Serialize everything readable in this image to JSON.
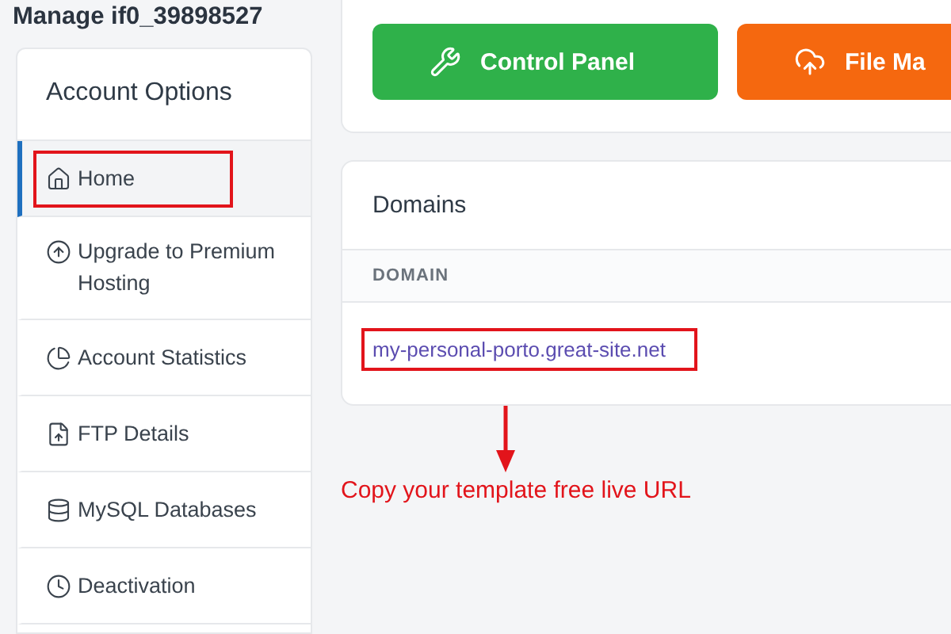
{
  "page_title": "Manage if0_39898527",
  "sidebar": {
    "title": "Account Options",
    "items": [
      {
        "label": "Home",
        "selected": true,
        "highlighted": true
      },
      {
        "label": "Upgrade to Premium Hosting",
        "selected": false,
        "highlighted": false
      },
      {
        "label": "Account Statistics",
        "selected": false,
        "highlighted": false
      },
      {
        "label": "FTP Details",
        "selected": false,
        "highlighted": false
      },
      {
        "label": "MySQL Databases",
        "selected": false,
        "highlighted": false
      },
      {
        "label": "Deactivation",
        "selected": false,
        "highlighted": false
      }
    ]
  },
  "actions": [
    {
      "label": "Control Panel",
      "kind": "green"
    },
    {
      "label": "File Ma",
      "kind": "orange"
    }
  ],
  "domains": {
    "title": "Domains",
    "columns": [
      "DOMAIN"
    ],
    "rows": [
      {
        "domain": "my-personal-porto.great-site.net",
        "highlighted": true
      }
    ]
  },
  "annotation": {
    "text": "Copy your template free live URL"
  }
}
